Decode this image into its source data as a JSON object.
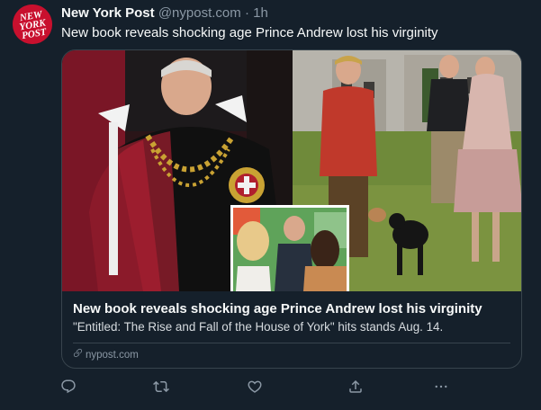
{
  "tweet": {
    "author_name": "New York Post",
    "handle": "@nypost.com",
    "separator": "·",
    "time": "1h",
    "text": "New book reveals shocking age Prince Andrew lost his virginity",
    "avatar_logo_text": [
      "NEW",
      "YORK",
      "POST"
    ]
  },
  "card": {
    "title": "New book reveals shocking age Prince Andrew lost his virginity",
    "description": "\"Entitled: The Rise and Fall of the House of York\" hits stands Aug. 14.",
    "domain": "nypost.com"
  },
  "actions": [
    {
      "icon": "reply-icon"
    },
    {
      "icon": "retweet-icon"
    },
    {
      "icon": "like-icon"
    },
    {
      "icon": "share-icon"
    },
    {
      "icon": "more-icon"
    }
  ],
  "colors": {
    "background": "#15202b",
    "border": "#38444d",
    "secondary_text": "#8b98a5",
    "brand_red": "#c8102e"
  }
}
